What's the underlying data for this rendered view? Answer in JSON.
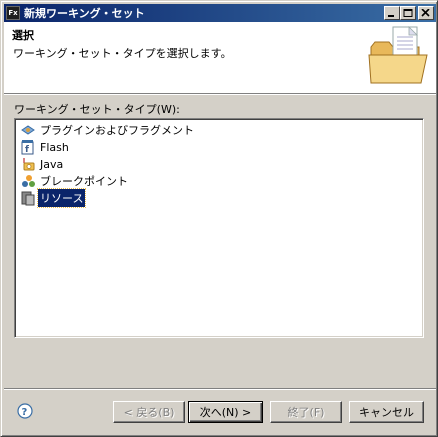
{
  "window": {
    "title": "新規ワーキング・セット",
    "app_icon_label": "Fx"
  },
  "header": {
    "title": "選択",
    "description": "ワーキング・セット・タイプを選択します。",
    "graphic_icon": "folder-with-document-icon"
  },
  "list": {
    "label": "ワーキング・セット・タイプ(W):",
    "items": [
      {
        "label": "プラグインおよびフラグメント",
        "icon": "plugin-icon",
        "selected": false
      },
      {
        "label": "Flash",
        "icon": "flash-icon",
        "selected": false
      },
      {
        "label": "Java",
        "icon": "java-icon",
        "selected": false
      },
      {
        "label": "ブレークポイント",
        "icon": "breakpoint-icon",
        "selected": false
      },
      {
        "label": "リソース",
        "icon": "resource-icon",
        "selected": true
      }
    ]
  },
  "buttons": {
    "back": "< 戻る(B)",
    "next": "次へ(N) >",
    "finish": "終了(F)",
    "cancel": "キャンセル"
  }
}
